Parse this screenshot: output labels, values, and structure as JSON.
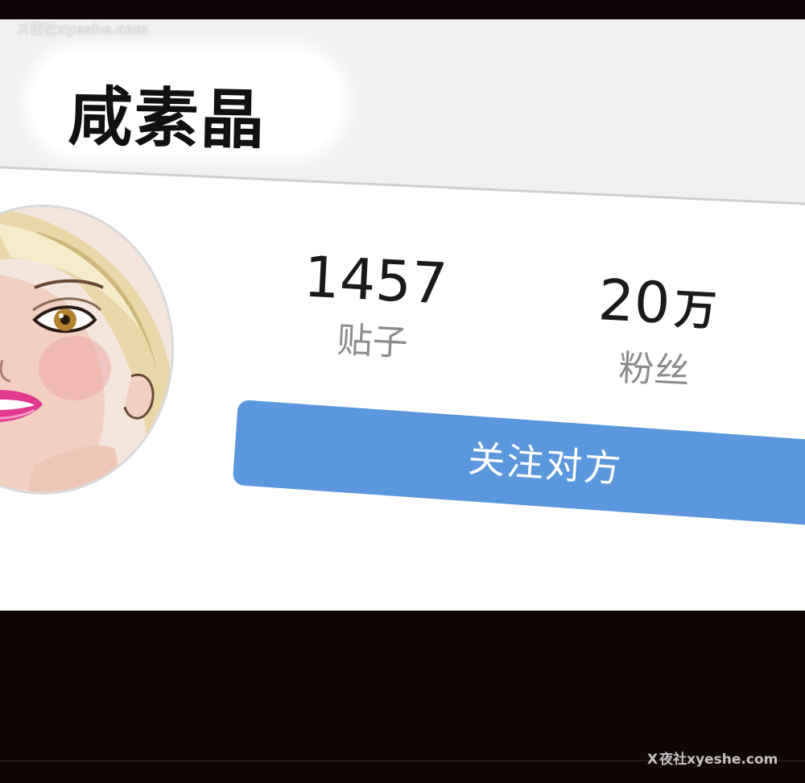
{
  "profile": {
    "name": "咸素晶"
  },
  "stats": {
    "posts": {
      "value": "1457",
      "label": "贴子"
    },
    "fans": {
      "value": "20",
      "unit": "万",
      "label": "粉丝"
    }
  },
  "actions": {
    "follow_label": "关注对方"
  },
  "watermark": {
    "icon": "X",
    "text": "夜社xyeshe.com"
  },
  "colors": {
    "follow_button": "#5b97dc",
    "background": "#100606",
    "panel": "#ffffff"
  }
}
